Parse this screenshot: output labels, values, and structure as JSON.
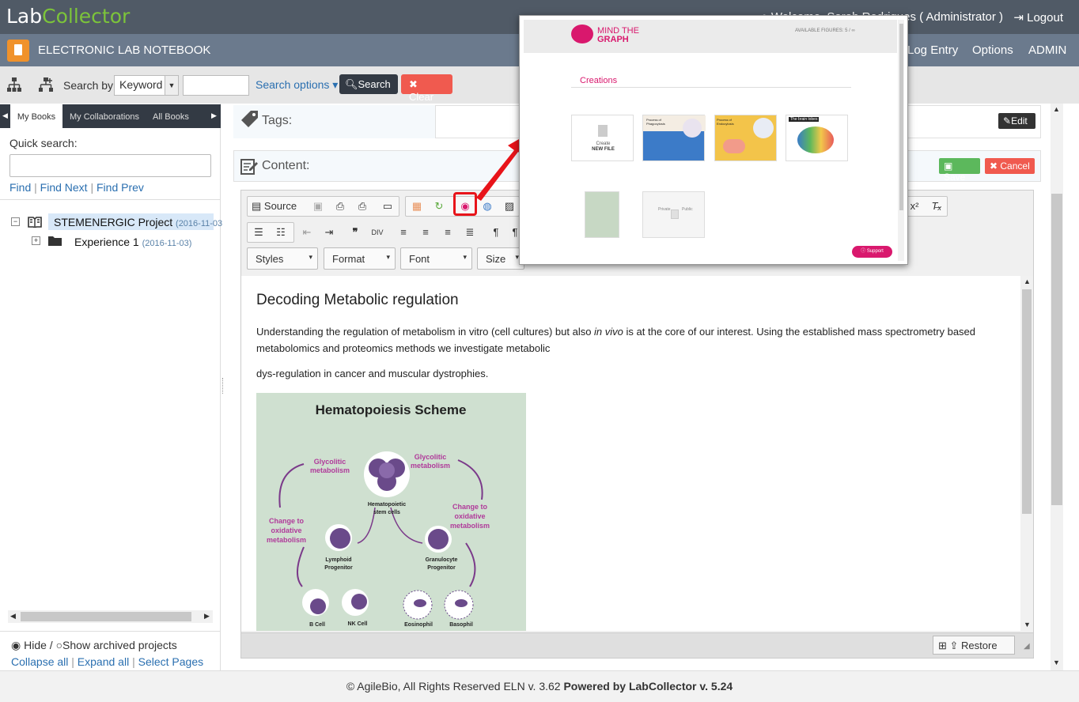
{
  "header": {
    "logo_lab": "Lab",
    "logo_collector": "Collector",
    "welcome": "Welcome, Sarah Rodrigues ( Administrator )",
    "logout": "Logout"
  },
  "modulebar": {
    "title": "ELECTRONIC LAB NOTEBOOK",
    "nav": [
      "Log Entry",
      "Options",
      "ADMIN"
    ]
  },
  "search": {
    "search_by": "Search by",
    "keyword": "Keyword",
    "options": "Search options",
    "search_btn": "Search",
    "clear_btn": "Clear"
  },
  "sidebar": {
    "tabs": [
      "My Books",
      "My Collaborations",
      "All Books"
    ],
    "quick_search": "Quick search:",
    "find": "Find",
    "find_next": "Find Next",
    "find_prev": "Find Prev",
    "tree": [
      {
        "label": "STEMENERGIC Project",
        "date": "(2016-11-03"
      },
      {
        "label": "Experience 1",
        "date": "(2016-11-03)"
      }
    ],
    "hide": "Hide /",
    "show_archived": "Show archived projects",
    "collapse_all": "Collapse all",
    "expand_all": "Expand all",
    "select_pages": "Select Pages"
  },
  "main": {
    "tags_label": "Tags:",
    "edit_btn": "Edit",
    "content_label": "Content:",
    "save_btn": "Save",
    "cancel_btn": "Cancel"
  },
  "editor": {
    "source_btn": "Source",
    "combos": [
      "Styles",
      "Format",
      "Font",
      "Size"
    ],
    "restore_btn": "Restore"
  },
  "document": {
    "title": "Decoding Metabolic regulation",
    "p1_a": "Understanding the regulation of metabolism in vitro (cell cultures) but also ",
    "p1_italic": "in vivo",
    "p1_b": " is at the core of our interest. Using the established mass spectrometry based metabolomics and proteomics methods we investigate metabolic",
    "p2": "dys-regulation in cancer and muscular dystrophies.",
    "infographic": {
      "title": "Hematopoiesis Scheme",
      "labels": {
        "glyco_left": "Glycolitic\nmetabolism",
        "glyco_right": "Glycolitic\nmetabolism",
        "change_left": "Change to\noxidative\nmetabolism",
        "change_right": "Change to\noxidative\nmetabolism",
        "stem": "Hematopoietic\nstem cells",
        "lymphoid": "Lymphoid\nProgenitor",
        "granulocyte": "Granulocyte\nProgenitor",
        "bcell": "B Cell",
        "nkcell": "NK Cell",
        "eosinophil": "Eosinophil",
        "basophil": "Basophil"
      }
    }
  },
  "popup": {
    "brand_line1": "MIND THE",
    "brand_line2": "GRAPH",
    "available": "AVAILABLE FIGURES: 5 / ∞",
    "creations": "Creations",
    "create_line1": "Create",
    "create_line2": "NEW FILE",
    "thumbs": [
      "Process of Phagocytosis",
      "Process of Endocytosis",
      "The brain lobes"
    ],
    "private": "Private",
    "public": "Public",
    "support": "Support"
  },
  "footer": {
    "copyright": "© AgileBio, All Rights Reserved ELN v. 3.62 ",
    "powered": "Powered by LabCollector v. 5.24"
  },
  "colors": {
    "topbar": "#505a66",
    "modulebar": "#6b7a8d",
    "accent_orange": "#f0922b",
    "save_green": "#5cb85c",
    "cancel_red": "#f05a4f",
    "mtg_pink": "#d9186d",
    "highlight_red": "#e8141a"
  },
  "icons": [
    "sitemap-icon",
    "tree-plus-icon",
    "search-icon",
    "times-icon",
    "tag-icon",
    "edit-icon",
    "save-icon",
    "mindthegraph-icon",
    "logout-icon",
    "user-icon"
  ]
}
